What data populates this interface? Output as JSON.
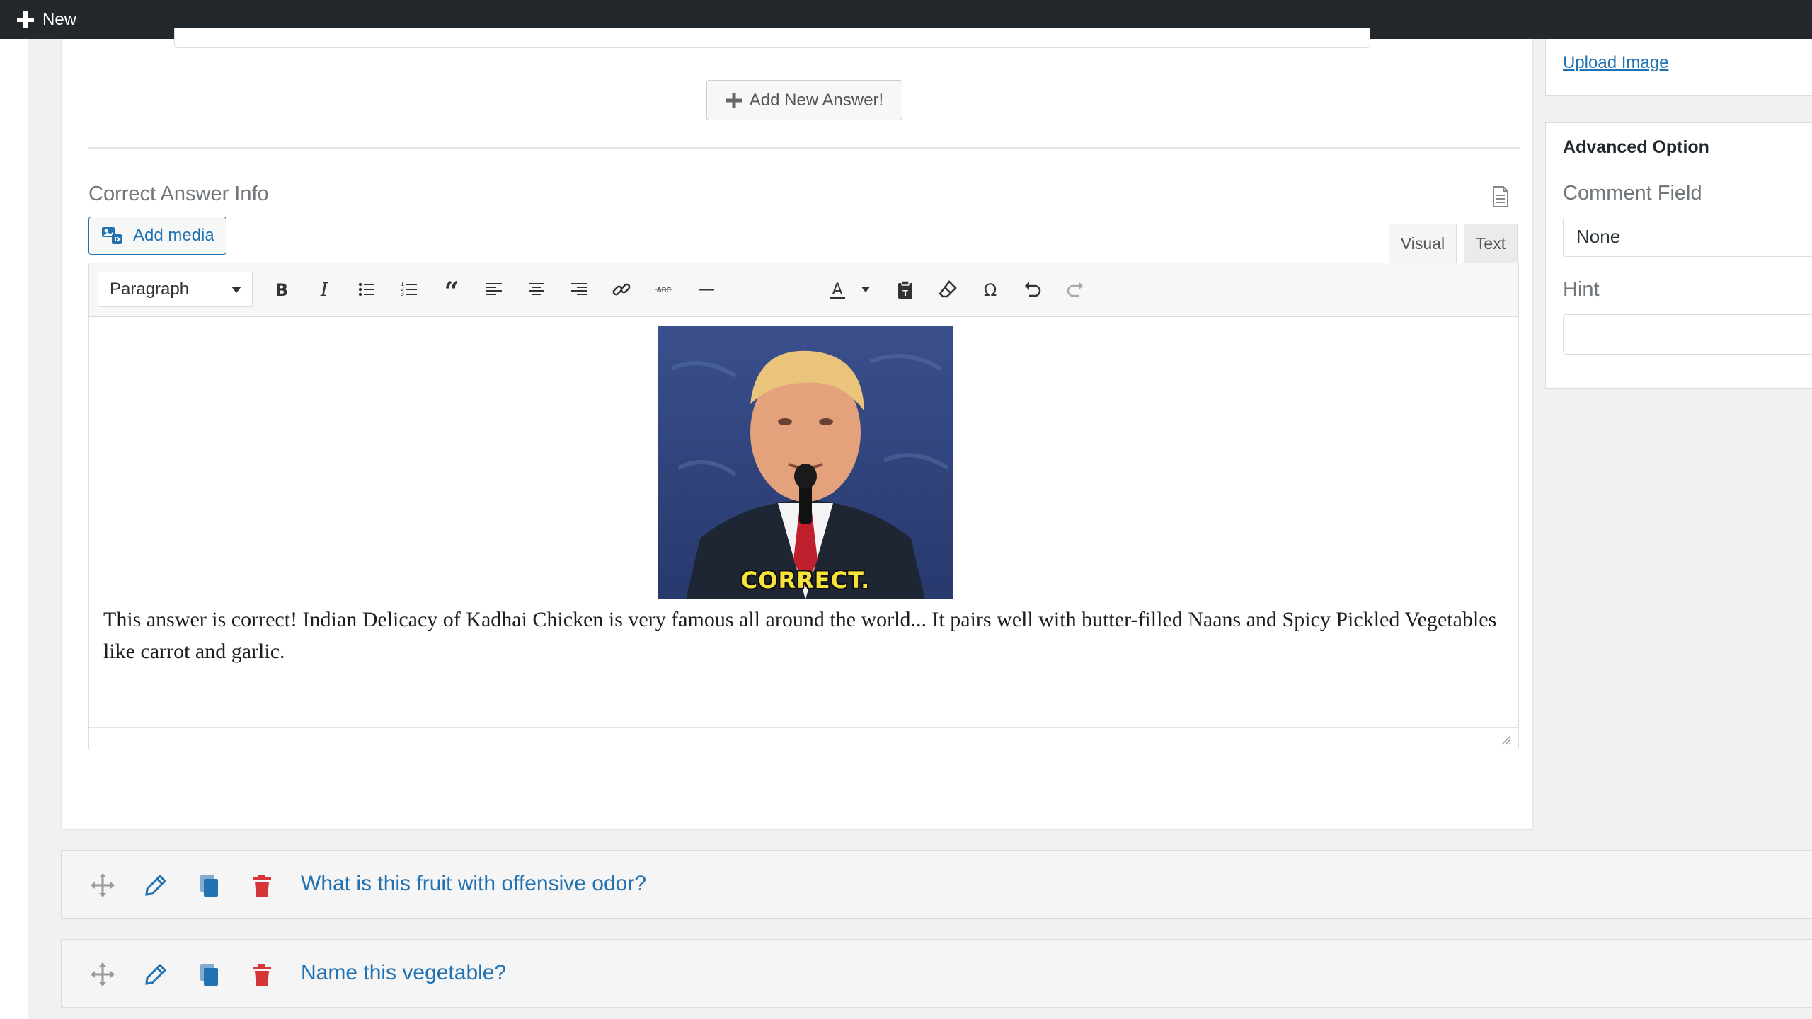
{
  "topbar": {
    "new_label": "New"
  },
  "question_editor": {
    "add_answer_label": "Add New Answer!",
    "correct_answer_info_title": "Correct Answer Info",
    "add_media_label": "Add media",
    "tabs": {
      "visual": "Visual",
      "text": "Text"
    },
    "format_select_value": "Paragraph",
    "toolbar_icons": [
      "bold-icon",
      "italic-icon",
      "bullet-list-icon",
      "numbered-list-icon",
      "blockquote-icon",
      "align-left-icon",
      "align-center-icon",
      "align-right-icon",
      "link-icon",
      "strikethrough-icon",
      "horizontal-line-icon",
      "text-color-icon",
      "paste-as-text-icon",
      "clear-formatting-icon",
      "special-character-icon",
      "undo-icon",
      "redo-icon"
    ],
    "gif_caption": "CORRECT.",
    "answer_text": "This answer is correct! Indian Delicacy of Kadhai Chicken is very famous all around the world... It pairs well with butter-filled Naans and Spicy Pickled Vegetables like carrot and garlic."
  },
  "sidebar": {
    "upload_image_label": "Upload Image",
    "advanced_option": {
      "title": "Advanced Option",
      "comment_field_label": "Comment Field",
      "comment_field_value": "None",
      "hint_label": "Hint",
      "hint_value": ""
    }
  },
  "questions": [
    {
      "title": "What is this fruit with offensive odor?"
    },
    {
      "title": "Name this vegetable?"
    }
  ],
  "colors": {
    "accent": "#2271b1",
    "topbar": "#23282d",
    "delete": "#d63638",
    "gif_caption": "#f6e23b"
  }
}
